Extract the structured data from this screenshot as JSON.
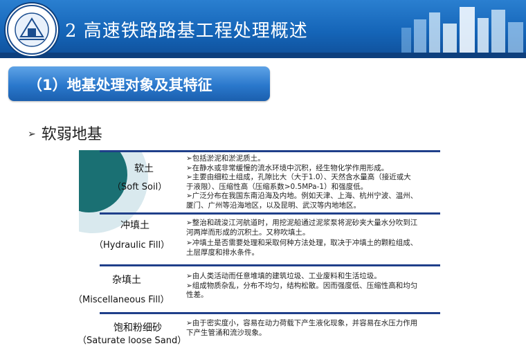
{
  "header": {
    "title": "2 高速铁路路基工程处理概述",
    "logo_text": "SOUTHWEST JIAOTONG UNIVERSITY"
  },
  "section": {
    "title": "（1）地基处理对象及其特征"
  },
  "bullet": {
    "arrow": "➢",
    "text": "软弱地基"
  },
  "table": {
    "rows": [
      {
        "name_cn": "软土",
        "name_en": "（Soft Soil）",
        "lines": [
          "➢包括淤泥和淤泥质土。",
          "➢在静水或非常缓慢的流水环境中沉积，经生物化学作用形成。",
          "➢主要由细粒土组成，孔隙比大（大于1.0）、天然含水量高（接近或大于液限）、压缩性高（压缩系数>0.5MPa-1）和强度低。",
          "➢广泛分布在我国东南沿海及内地。例如天津、上海、杭州宁波、温州、厦门、广州等沿海地区，以及昆明、武汉等内地地区。"
        ]
      },
      {
        "name_cn": "冲填土",
        "name_en": "（Hydraulic Fill）",
        "lines": [
          "➢整治和疏浚江河航道时，用挖泥船通过泥浆泵将泥砂夹大量水分吹到江河两岸而形成的沉积土。又称吹填土。",
          "➢冲填土是否需要处理和采取何种方法处理，取决于冲填土的颗粒组成、土层厚度和排水条件。"
        ]
      },
      {
        "name_cn": "杂填土",
        "name_en": "（Miscellaneous Fill）",
        "lines": [
          "➢由人类活动而任意堆填的建筑垃圾、工业废料和生活垃圾。",
          "➢组成物质杂乱，分布不均匀，结构松散。因而强度低、压缩性高和均匀性差。"
        ]
      },
      {
        "name_cn": "饱和粉细砂",
        "name_en": "（Saturate loose Sand）",
        "lines": [
          "➢由于密实度小，容易在动力荷载下产生液化现象，并容易在水压力作用下产生管涌和流沙现象。"
        ]
      }
    ]
  }
}
